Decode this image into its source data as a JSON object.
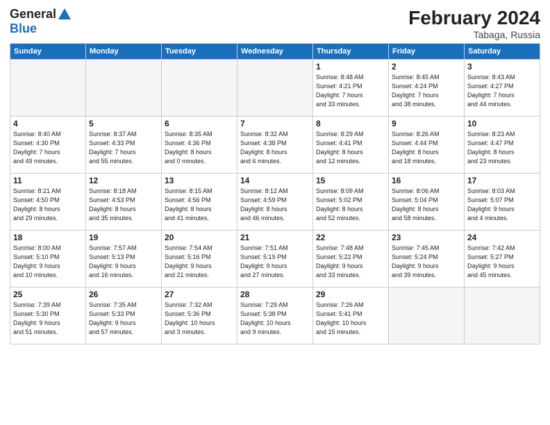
{
  "header": {
    "logo_line1": "General",
    "logo_line2": "Blue",
    "month_title": "February 2024",
    "location": "Tabaga, Russia"
  },
  "weekdays": [
    "Sunday",
    "Monday",
    "Tuesday",
    "Wednesday",
    "Thursday",
    "Friday",
    "Saturday"
  ],
  "weeks": [
    [
      {
        "day": "",
        "text": "",
        "empty": true
      },
      {
        "day": "",
        "text": "",
        "empty": true
      },
      {
        "day": "",
        "text": "",
        "empty": true
      },
      {
        "day": "",
        "text": "",
        "empty": true
      },
      {
        "day": "1",
        "text": "Sunrise: 8:48 AM\nSunset: 4:21 PM\nDaylight: 7 hours\nand 33 minutes.",
        "empty": false
      },
      {
        "day": "2",
        "text": "Sunrise: 8:45 AM\nSunset: 4:24 PM\nDaylight: 7 hours\nand 38 minutes.",
        "empty": false
      },
      {
        "day": "3",
        "text": "Sunrise: 8:43 AM\nSunset: 4:27 PM\nDaylight: 7 hours\nand 44 minutes.",
        "empty": false
      }
    ],
    [
      {
        "day": "4",
        "text": "Sunrise: 8:40 AM\nSunset: 4:30 PM\nDaylight: 7 hours\nand 49 minutes.",
        "empty": false
      },
      {
        "day": "5",
        "text": "Sunrise: 8:37 AM\nSunset: 4:33 PM\nDaylight: 7 hours\nand 55 minutes.",
        "empty": false
      },
      {
        "day": "6",
        "text": "Sunrise: 8:35 AM\nSunset: 4:36 PM\nDaylight: 8 hours\nand 0 minutes.",
        "empty": false
      },
      {
        "day": "7",
        "text": "Sunrise: 8:32 AM\nSunset: 4:38 PM\nDaylight: 8 hours\nand 6 minutes.",
        "empty": false
      },
      {
        "day": "8",
        "text": "Sunrise: 8:29 AM\nSunset: 4:41 PM\nDaylight: 8 hours\nand 12 minutes.",
        "empty": false
      },
      {
        "day": "9",
        "text": "Sunrise: 8:26 AM\nSunset: 4:44 PM\nDaylight: 8 hours\nand 18 minutes.",
        "empty": false
      },
      {
        "day": "10",
        "text": "Sunrise: 8:23 AM\nSunset: 4:47 PM\nDaylight: 8 hours\nand 23 minutes.",
        "empty": false
      }
    ],
    [
      {
        "day": "11",
        "text": "Sunrise: 8:21 AM\nSunset: 4:50 PM\nDaylight: 8 hours\nand 29 minutes.",
        "empty": false
      },
      {
        "day": "12",
        "text": "Sunrise: 8:18 AM\nSunset: 4:53 PM\nDaylight: 8 hours\nand 35 minutes.",
        "empty": false
      },
      {
        "day": "13",
        "text": "Sunrise: 8:15 AM\nSunset: 4:56 PM\nDaylight: 8 hours\nand 41 minutes.",
        "empty": false
      },
      {
        "day": "14",
        "text": "Sunrise: 8:12 AM\nSunset: 4:59 PM\nDaylight: 8 hours\nand 46 minutes.",
        "empty": false
      },
      {
        "day": "15",
        "text": "Sunrise: 8:09 AM\nSunset: 5:02 PM\nDaylight: 8 hours\nand 52 minutes.",
        "empty": false
      },
      {
        "day": "16",
        "text": "Sunrise: 8:06 AM\nSunset: 5:04 PM\nDaylight: 8 hours\nand 58 minutes.",
        "empty": false
      },
      {
        "day": "17",
        "text": "Sunrise: 8:03 AM\nSunset: 5:07 PM\nDaylight: 9 hours\nand 4 minutes.",
        "empty": false
      }
    ],
    [
      {
        "day": "18",
        "text": "Sunrise: 8:00 AM\nSunset: 5:10 PM\nDaylight: 9 hours\nand 10 minutes.",
        "empty": false
      },
      {
        "day": "19",
        "text": "Sunrise: 7:57 AM\nSunset: 5:13 PM\nDaylight: 9 hours\nand 16 minutes.",
        "empty": false
      },
      {
        "day": "20",
        "text": "Sunrise: 7:54 AM\nSunset: 5:16 PM\nDaylight: 9 hours\nand 21 minutes.",
        "empty": false
      },
      {
        "day": "21",
        "text": "Sunrise: 7:51 AM\nSunset: 5:19 PM\nDaylight: 9 hours\nand 27 minutes.",
        "empty": false
      },
      {
        "day": "22",
        "text": "Sunrise: 7:48 AM\nSunset: 5:22 PM\nDaylight: 9 hours\nand 33 minutes.",
        "empty": false
      },
      {
        "day": "23",
        "text": "Sunrise: 7:45 AM\nSunset: 5:24 PM\nDaylight: 9 hours\nand 39 minutes.",
        "empty": false
      },
      {
        "day": "24",
        "text": "Sunrise: 7:42 AM\nSunset: 5:27 PM\nDaylight: 9 hours\nand 45 minutes.",
        "empty": false
      }
    ],
    [
      {
        "day": "25",
        "text": "Sunrise: 7:39 AM\nSunset: 5:30 PM\nDaylight: 9 hours\nand 51 minutes.",
        "empty": false
      },
      {
        "day": "26",
        "text": "Sunrise: 7:35 AM\nSunset: 5:33 PM\nDaylight: 9 hours\nand 57 minutes.",
        "empty": false
      },
      {
        "day": "27",
        "text": "Sunrise: 7:32 AM\nSunset: 5:36 PM\nDaylight: 10 hours\nand 3 minutes.",
        "empty": false
      },
      {
        "day": "28",
        "text": "Sunrise: 7:29 AM\nSunset: 5:38 PM\nDaylight: 10 hours\nand 9 minutes.",
        "empty": false
      },
      {
        "day": "29",
        "text": "Sunrise: 7:26 AM\nSunset: 5:41 PM\nDaylight: 10 hours\nand 15 minutes.",
        "empty": false
      },
      {
        "day": "",
        "text": "",
        "empty": true
      },
      {
        "day": "",
        "text": "",
        "empty": true
      }
    ]
  ]
}
